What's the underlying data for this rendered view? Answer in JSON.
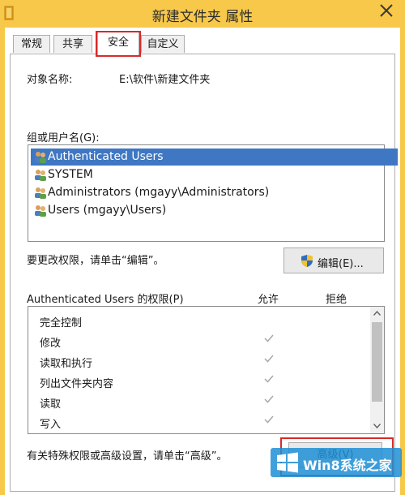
{
  "window": {
    "title": "新建文件夹 属性"
  },
  "tabs": [
    {
      "label": "常规"
    },
    {
      "label": "共享"
    },
    {
      "label": "安全"
    },
    {
      "label": "自定义"
    }
  ],
  "security": {
    "object_name_label": "对象名称:",
    "object_name_value": "E:\\软件\\新建文件夹",
    "group_label": "组或用户名(G):",
    "users": [
      {
        "name": "Authenticated Users",
        "selected": true
      },
      {
        "name": "SYSTEM",
        "selected": false
      },
      {
        "name": "Administrators (mgayy\\Administrators)",
        "selected": false
      },
      {
        "name": "Users (mgayy\\Users)",
        "selected": false
      }
    ],
    "change_hint": "要更改权限，请单击“编辑”。",
    "edit_button": "编辑(E)...",
    "permissions_for_label": "Authenticated Users 的权限(P)",
    "allow_header": "允许",
    "deny_header": "拒绝",
    "permissions": [
      {
        "name": "完全控制",
        "allow": false
      },
      {
        "name": "修改",
        "allow": true
      },
      {
        "name": "读取和执行",
        "allow": true
      },
      {
        "name": "列出文件夹内容",
        "allow": true
      },
      {
        "name": "读取",
        "allow": true
      },
      {
        "name": "写入",
        "allow": true
      }
    ],
    "advanced_hint": "有关特殊权限或高级设置，请单击“高级”。",
    "advanced_button": "高级(V)"
  },
  "watermark": {
    "text": "Win8系统之家"
  },
  "colors": {
    "title_bar": "#f7c84a",
    "selection": "#3f77c3",
    "highlight_box": "#d62b2b",
    "watermark_blue": "#1f8fd6"
  }
}
